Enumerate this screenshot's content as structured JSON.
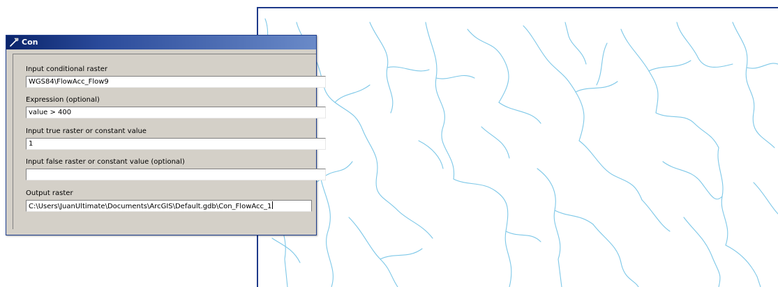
{
  "dialog": {
    "title": "Con",
    "fields": [
      {
        "label": "Input conditional raster",
        "value": "WGS84\\FlowAcc_Flow9"
      },
      {
        "label": "Expression (optional)",
        "value": "value > 400"
      },
      {
        "label": "Input true raster or constant value",
        "value": "1"
      },
      {
        "label": "Input false raster or constant value (optional)",
        "value": ""
      },
      {
        "label": "Output raster",
        "value": "C:\\Users\\JuanUltimate\\Documents\\ArcGIS\\Default.gdb\\Con_FlowAcc_1"
      }
    ]
  },
  "map": {
    "stream_color": "#7ec8e8",
    "border_color": "#1e3a8a"
  },
  "colors": {
    "title_bar": "#0a246a",
    "dialog_bg": "#d4d0c8"
  }
}
